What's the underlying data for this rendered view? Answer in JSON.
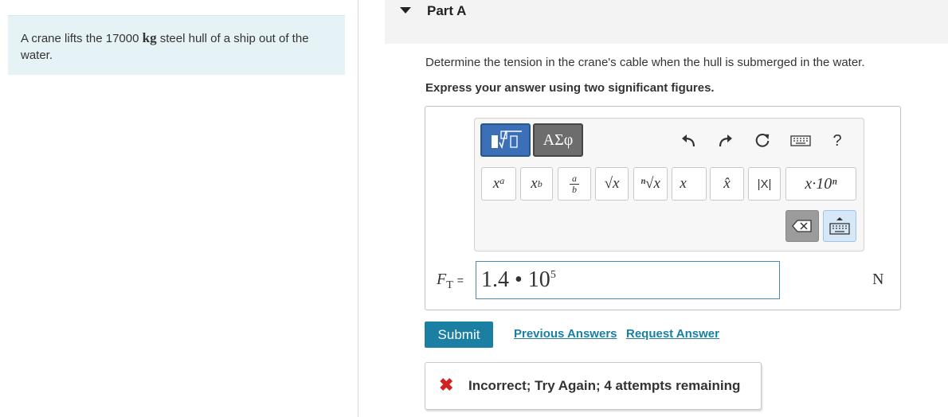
{
  "problem": {
    "text_before": "A crane lifts the 17000 ",
    "unit": "kg",
    "text_after": " steel hull of a ship out of the water."
  },
  "part": {
    "title": "Part A"
  },
  "question": "Determine the tension in the crane's cable when the hull is submerged in the water.",
  "instruction": "Express your answer using two significant figures.",
  "toolbar": {
    "templates_icon": "templates-icon",
    "symbols_label": "ΑΣφ",
    "help_label": "?",
    "keys": [
      {
        "name": "superscript-key",
        "label": "x",
        "sub": "a"
      },
      {
        "name": "subscript-key",
        "label": "x",
        "sub": "b"
      },
      {
        "name": "fraction-key",
        "num": "a",
        "den": "b"
      },
      {
        "name": "square-root-key",
        "label": "√x"
      },
      {
        "name": "nth-root-key",
        "label": "ⁿ√x"
      },
      {
        "name": "vector-key",
        "label": "x⃗"
      },
      {
        "name": "unit-vector-key",
        "label": "x̂"
      },
      {
        "name": "absolute-value-key",
        "label": "|X|"
      },
      {
        "name": "scientific-notation-key",
        "label": "x·10ⁿ"
      }
    ]
  },
  "answer": {
    "variable": "F",
    "variable_sub": "T",
    "equals": "=",
    "value_mantissa": "1.4 • 10",
    "value_exponent": "5",
    "unit": "N"
  },
  "actions": {
    "submit_label": "Submit",
    "previous_answers_label": "Previous Answers",
    "request_answer_label": "Request Answer"
  },
  "feedback": {
    "icon": "x-icon",
    "symbol": "✖",
    "text": "Incorrect; Try Again; 4 attempts remaining",
    "color": "#d32020"
  },
  "colors": {
    "accent": "#1a7fa3",
    "problem_bg": "#e6f3f6",
    "template_btn": "#3b6fb6"
  }
}
